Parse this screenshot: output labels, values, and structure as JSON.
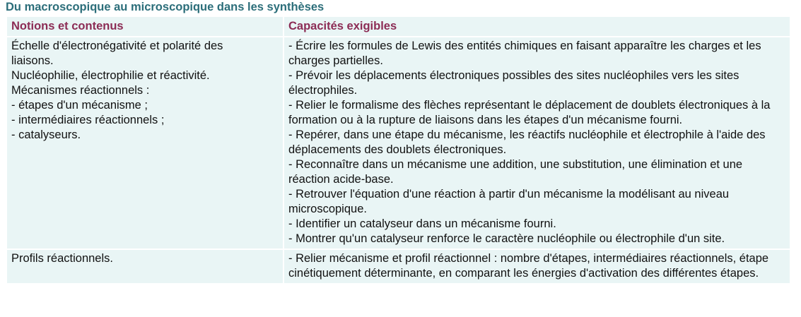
{
  "title": "Du macroscopique au microscopique dans les synthèses",
  "headers": {
    "notions": "Notions et contenus",
    "capacites": "Capacités exigibles"
  },
  "rows": [
    {
      "notions": [
        "Échelle d'électronégativité et polarité des",
        "liaisons.",
        "Nucléophilie, électrophilie et réactivité.",
        "Mécanismes réactionnels :",
        "- étapes d'un mécanisme ;",
        "- intermédiaires réactionnels ;",
        "- catalyseurs."
      ],
      "capacites": [
        "- Écrire les formules de Lewis des entités chimiques en faisant apparaître les charges et les charges partielles.",
        "- Prévoir les déplacements électroniques possibles des sites nucléophiles vers les sites électrophiles.",
        "- Relier le formalisme des flèches représentant le déplacement de doublets électroniques à la formation ou à la rupture de liaisons dans les étapes d'un mécanisme fourni.",
        "- Repérer, dans une étape du mécanisme, les réactifs nucléophile et électrophile à l'aide des déplacements des doublets électroniques.",
        "- Reconnaître dans un mécanisme une addition, une substitution, une élimination et une réaction acide-base.",
        "- Retrouver l'équation d'une réaction à partir d'un mécanisme la modélisant au niveau microscopique.",
        "- Identifier un catalyseur dans un mécanisme fourni.",
        "- Montrer qu'un catalyseur renforce le caractère nucléophile ou électrophile d'un site."
      ]
    },
    {
      "notions": [
        "Profils réactionnels."
      ],
      "capacites": [
        "- Relier mécanisme et profil réactionnel : nombre d'étapes, intermédiaires réactionnels, étape cinétiquement déterminante, en comparant les énergies d'activation des différentes étapes."
      ]
    }
  ]
}
